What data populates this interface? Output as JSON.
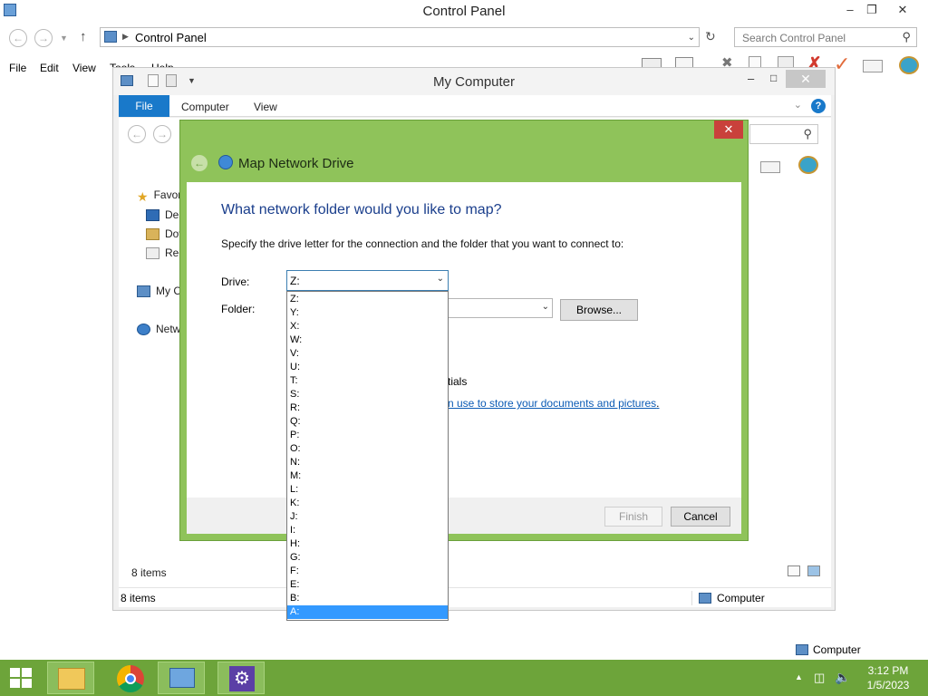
{
  "control_panel": {
    "title": "Control Panel",
    "address_path": "Control Panel",
    "search_placeholder": "Search Control Panel",
    "menu": [
      "File",
      "Edit",
      "View",
      "Tools",
      "Help"
    ]
  },
  "my_computer": {
    "title": "My Computer",
    "tabs": {
      "file": "File",
      "computer": "Computer",
      "view": "View"
    },
    "nav": {
      "favorites": "Favor",
      "desktop": "Des",
      "downloads": "Dov",
      "recent": "Rec",
      "computer": "My C",
      "network": "Netw"
    },
    "items_count_inner": "8 items",
    "items_count": "8 items",
    "status_location": "Computer"
  },
  "dialog": {
    "title": "Map Network Drive",
    "heading": "What network folder would you like to map?",
    "instruction": "Specify the drive letter for the connection and the folder that you want to connect to:",
    "drive_label": "Drive:",
    "folder_label": "Folder:",
    "drive_value": "Z:",
    "browse_label": "Browse...",
    "credentials_fragment": "tials",
    "link_fragment": "n use to store your documents and pictures",
    "link_suffix": ".",
    "finish_label": "Finish",
    "cancel_label": "Cancel",
    "drive_options": [
      "Z:",
      "Y:",
      "X:",
      "W:",
      "V:",
      "U:",
      "T:",
      "S:",
      "R:",
      "Q:",
      "P:",
      "O:",
      "N:",
      "M:",
      "L:",
      "K:",
      "J:",
      "I:",
      "H:",
      "G:",
      "F:",
      "E:",
      "B:",
      "A:"
    ],
    "highlighted_option": "A:"
  },
  "desktop": {
    "location_label": "Computer"
  },
  "taskbar": {
    "time": "3:12 PM",
    "date": "1/5/2023"
  },
  "colors": {
    "dialog_frame": "#8fc35a",
    "taskbar": "#6da43a",
    "accent_blue": "#1979ca",
    "heading_blue": "#1a3e8c",
    "selection": "#3399ff",
    "close_red": "#c9413b"
  }
}
